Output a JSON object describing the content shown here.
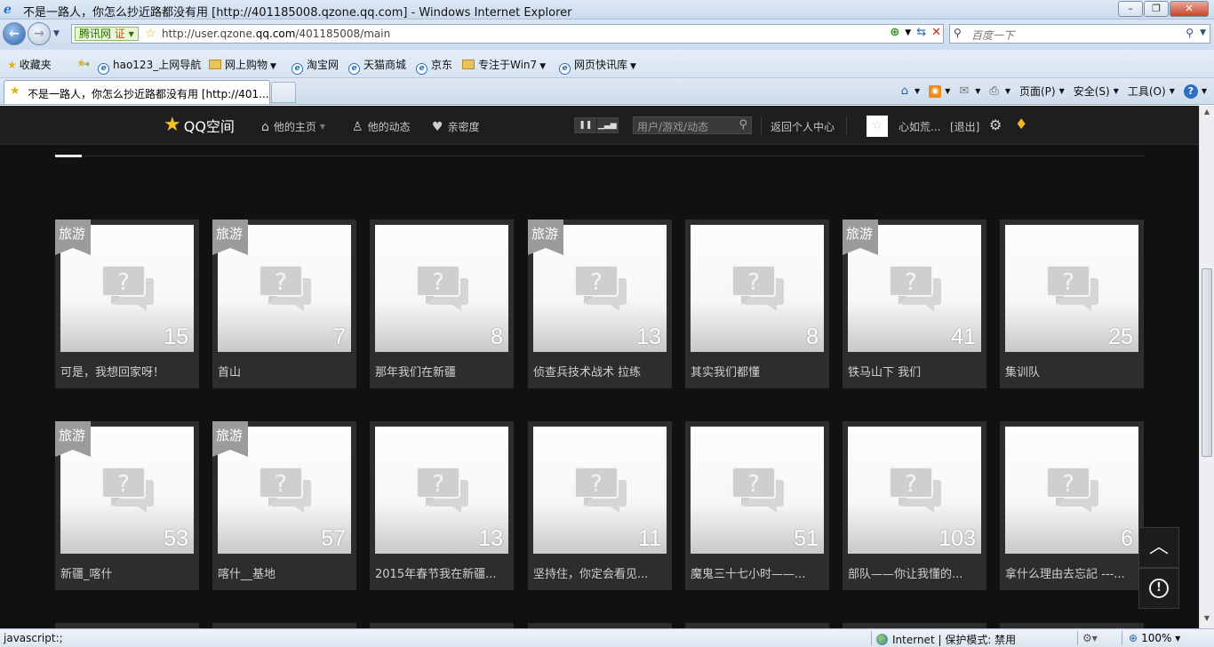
{
  "window": {
    "title": "不是一路人，你怎么抄近路都没有用 [http://401185008.qzone.qq.com] - Windows Internet Explorer",
    "minimize": "–",
    "maximize": "❐",
    "close": "✕"
  },
  "navbar": {
    "cert_brand": "腾讯网",
    "cert_badge": "证",
    "url_prefix": "http://user.qzone.",
    "url_domain": "qq.com",
    "url_suffix": "/401185008/main",
    "search_placeholder": "百度一下"
  },
  "favorites": {
    "label": "收藏夹",
    "items": [
      {
        "label": "hao123_上网导航",
        "icon": "ie-page-icon"
      },
      {
        "label": "网上购物",
        "icon": "folder-icon",
        "dropdown": true
      },
      {
        "label": "淘宝网",
        "icon": "ie-page-icon"
      },
      {
        "label": "天猫商城",
        "icon": "ie-page-icon"
      },
      {
        "label": "京东",
        "icon": "ie-page-icon"
      },
      {
        "label": "专注于Win7",
        "icon": "folder-icon",
        "dropdown": true
      },
      {
        "label": "网页快讯库",
        "icon": "ie-page-icon",
        "dropdown": true
      }
    ]
  },
  "tab": {
    "label": "不是一路人，你怎么抄近路都没有用 [http://401..."
  },
  "commandbar": {
    "page": "页面(P)",
    "safety": "安全(S)",
    "tools": "工具(O)"
  },
  "qzone": {
    "logo": "QQ空间",
    "nav": {
      "home": "他的主页",
      "feeds": "他的动态",
      "intimacy": "亲密度"
    },
    "search_placeholder": "用户/游戏/动态",
    "return_center": "返回个人中心",
    "username": "心如荒...",
    "logout": "[退出]"
  },
  "albums": [
    {
      "tag": "旅游",
      "count": "15",
      "name": "可是，我想回家呀！"
    },
    {
      "tag": "旅游",
      "count": "7",
      "name": "首山"
    },
    {
      "tag": "",
      "count": "8",
      "name": "那年我们在新疆"
    },
    {
      "tag": "旅游",
      "count": "13",
      "name": "侦查兵技术战术 拉练"
    },
    {
      "tag": "",
      "count": "8",
      "name": "其实我们都懂"
    },
    {
      "tag": "旅游",
      "count": "41",
      "name": "铁马山下 我们"
    },
    {
      "tag": "",
      "count": "25",
      "name": "集训队"
    },
    {
      "tag": "旅游",
      "count": "53",
      "name": "新疆_喀什"
    },
    {
      "tag": "旅游",
      "count": "57",
      "name": "喀什__基地"
    },
    {
      "tag": "",
      "count": "13",
      "name": "2015年春节我在新疆..."
    },
    {
      "tag": "",
      "count": "11",
      "name": "坚持住，你定会看见..."
    },
    {
      "tag": "",
      "count": "51",
      "name": "魔鬼三十七小时——..."
    },
    {
      "tag": "",
      "count": "103",
      "name": "部队——你让我懂的..."
    },
    {
      "tag": "",
      "count": "6",
      "name": "拿什么理由去忘記 ---..."
    }
  ],
  "statusbar": {
    "message": "javascript:;",
    "zone": "Internet | 保护模式: 禁用",
    "zoom": "100%"
  }
}
